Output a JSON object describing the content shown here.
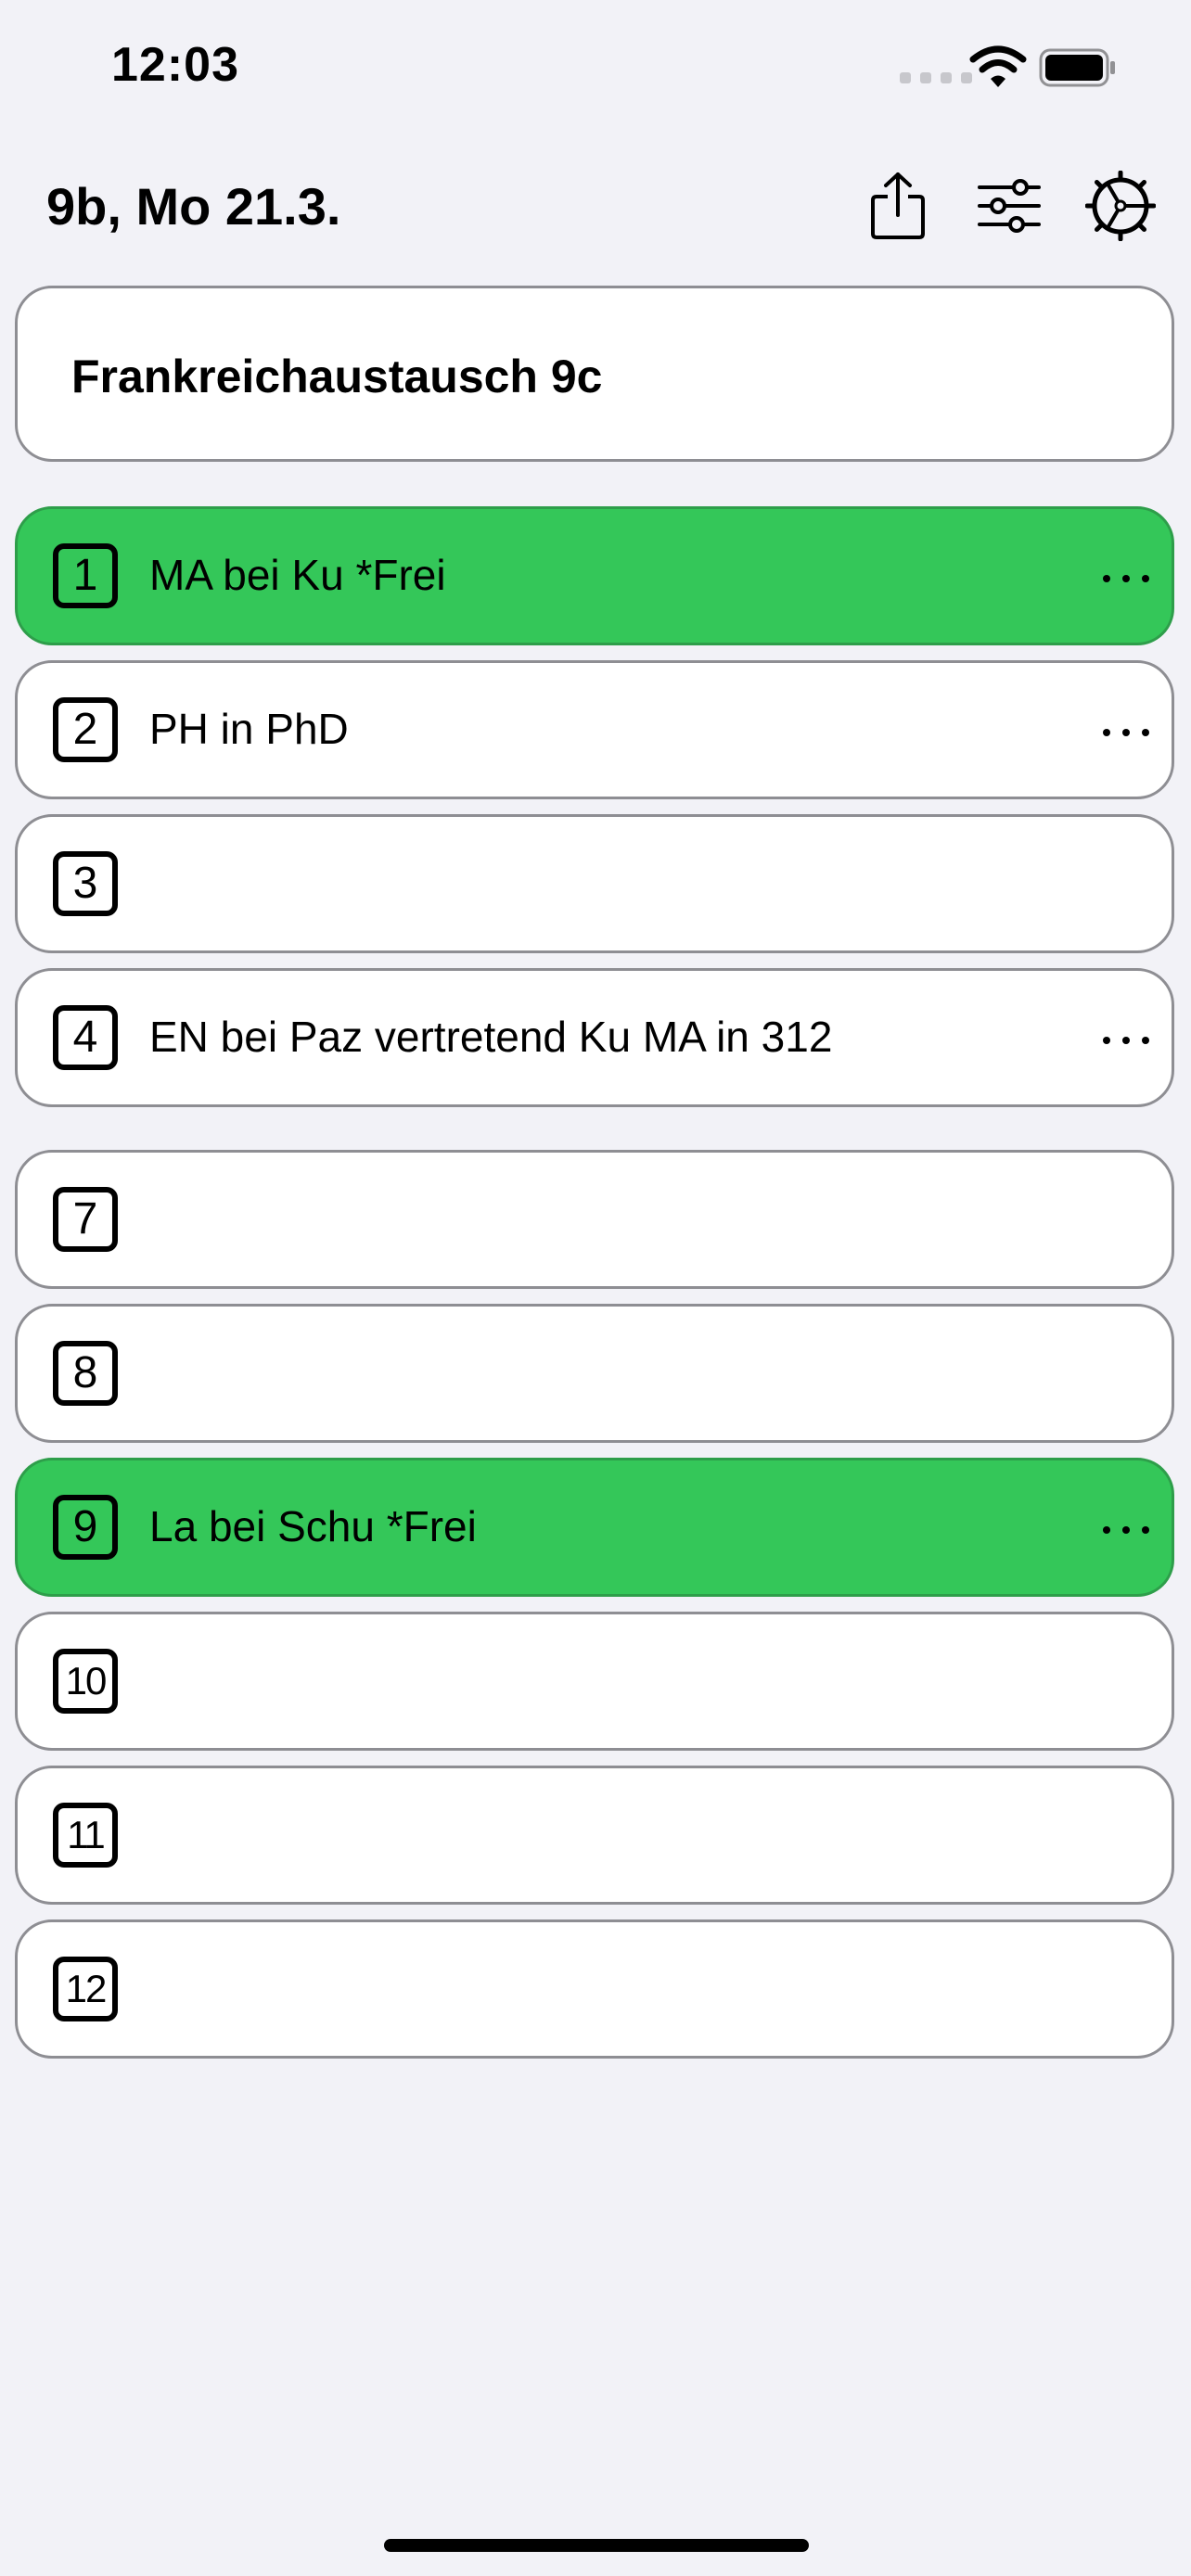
{
  "status_bar": {
    "time": "12:03"
  },
  "header": {
    "title": "9b, Mo 21.3."
  },
  "note": {
    "text": "Frankreichaustausch 9c"
  },
  "lessons": [
    {
      "number": "1",
      "text": "MA bei Ku *Frei",
      "highlighted": true,
      "has_menu": true
    },
    {
      "number": "2",
      "text": "PH in PhD",
      "highlighted": false,
      "has_menu": true
    },
    {
      "number": "3",
      "text": "",
      "highlighted": false,
      "has_menu": false
    },
    {
      "number": "4",
      "text": "EN bei Paz vertretend Ku MA in 312",
      "highlighted": false,
      "has_menu": true
    },
    {
      "number": "7",
      "text": "",
      "highlighted": false,
      "has_menu": false
    },
    {
      "number": "8",
      "text": "",
      "highlighted": false,
      "has_menu": false
    },
    {
      "number": "9",
      "text": "La bei Schu *Frei",
      "highlighted": true,
      "has_menu": true
    },
    {
      "number": "10",
      "text": "",
      "highlighted": false,
      "has_menu": false
    },
    {
      "number": "11",
      "text": "",
      "highlighted": false,
      "has_menu": false
    },
    {
      "number": "12",
      "text": "",
      "highlighted": false,
      "has_menu": false
    }
  ],
  "colors": {
    "highlight": "#34C759",
    "background": "#F2F2F7",
    "card": "#FFFFFF",
    "border": "#8E8E93"
  },
  "icons": [
    "share-icon",
    "filter-sliders-icon",
    "settings-wheel-icon",
    "more-icon",
    "wifi-icon",
    "battery-icon"
  ]
}
